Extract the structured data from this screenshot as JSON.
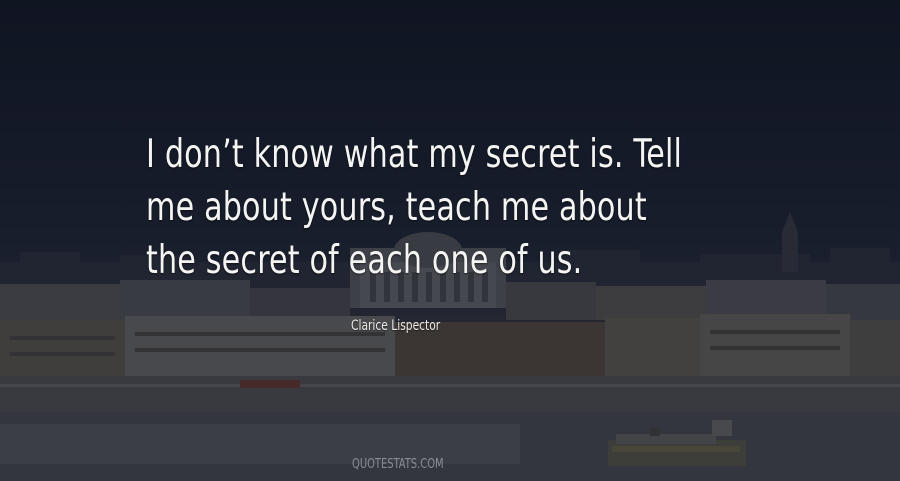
{
  "quote": {
    "text": "I don’t know what my secret is. Tell me about yours, teach me about the secret of each one of us."
  },
  "author": {
    "name": "Clarice Lispector"
  },
  "watermark": {
    "text": "QUOTESTATS.COM"
  },
  "colors": {
    "sky": "#1b2233",
    "text": "#f4f4f2",
    "water": "#50535a"
  }
}
